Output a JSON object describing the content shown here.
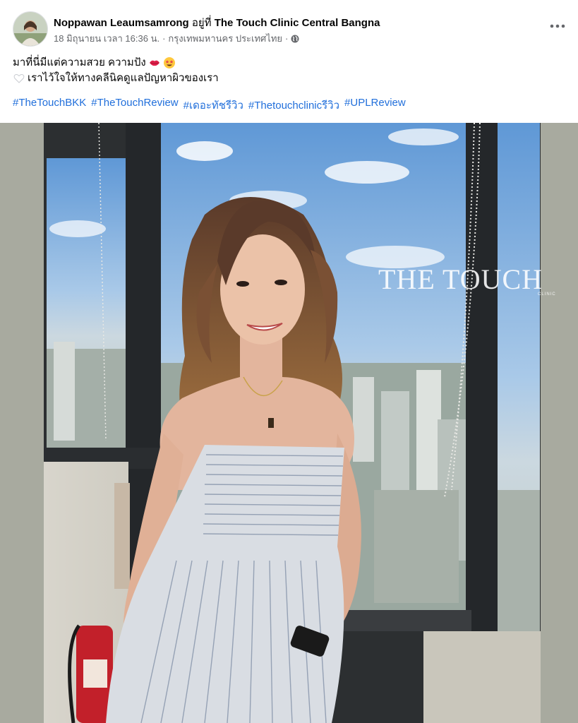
{
  "post": {
    "author": "Noppawan Leaumsamrong",
    "at_text": "อยู่ที่",
    "location": "The Touch Clinic Central Bangna",
    "timestamp": "18 มิถุนายน เวลา 16:36 น.",
    "separator": "·",
    "place": "กรุงเทพมหานคร ประเทศไทย",
    "privacy_icon": "globe-icon",
    "more_icon": "more-options-icon",
    "caption_line_1": "มาที่นี่มีแต่ความสวย ความปัง",
    "caption_line_2": "เราไว้ใจให้ทางคลีนิคดูแลปัญหาผิวของเรา",
    "hashtags": [
      "#TheTouchBKK",
      "#TheTouchReview",
      "#เดอะทัชรีวิว",
      "#Thetouchclinicรีวิว",
      "#UPLReview"
    ],
    "watermark": "THE TOUCH",
    "watermark_sub": "CLINIC"
  },
  "colors": {
    "text_primary": "#050505",
    "text_secondary": "#65676b",
    "hashtag": "#216fdb",
    "sky": "#7fb0df"
  }
}
